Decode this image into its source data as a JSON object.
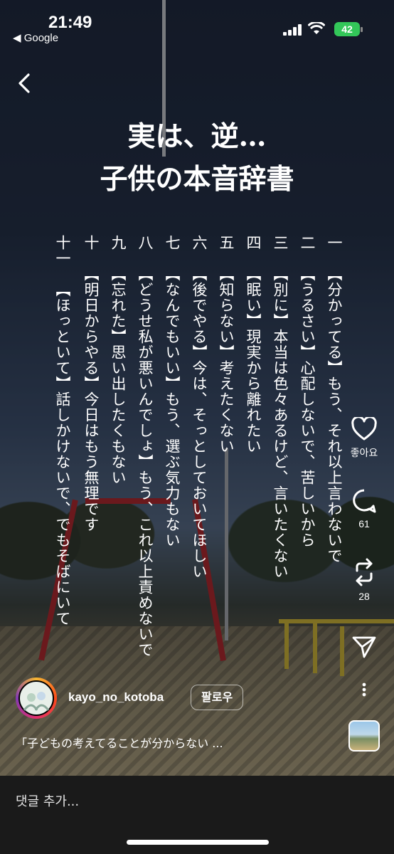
{
  "status_bar": {
    "time": "21:49",
    "back_app": "◀ Google",
    "battery": "42"
  },
  "post": {
    "headline_line1": "実は、逆…",
    "headline_line2": "子供の本音辞書",
    "entries": [
      {
        "num": "一",
        "text": "【分かってる】もう、それ以上言わないで"
      },
      {
        "num": "二",
        "text": "【うるさい】心配しないで、苦しいから"
      },
      {
        "num": "三",
        "text": "【別に】本当は色々あるけど、言いたくない"
      },
      {
        "num": "四",
        "text": "【眠い】現実から離れたい"
      },
      {
        "num": "五",
        "text": "【知らない】考えたくない"
      },
      {
        "num": "六",
        "text": "【後でやる】今は、そっとしておいてほしい"
      },
      {
        "num": "七",
        "text": "【なんでもいい】もう、選ぶ気力もない"
      },
      {
        "num": "八",
        "text": "【どうせ私が悪いんでしょ】もう、これ以上責めないで"
      },
      {
        "num": "九",
        "text": "【忘れた】思い出したくもない"
      },
      {
        "num": "十",
        "text": "【明日からやる】今日はもう無理です"
      },
      {
        "num": "十一",
        "text": "【ほっといて】話しかけないで、でもそばにいて"
      }
    ]
  },
  "actions": {
    "like_label": "좋아요",
    "comment_count": "61",
    "repost_count": "28"
  },
  "account": {
    "username": "kayo_no_kotoba",
    "follow_label": "팔로우",
    "caption": "「子どもの考えてることが分からない ..."
  },
  "comment_bar": {
    "placeholder": "댓글 추가..."
  },
  "colors": {
    "battery_green": "#33c759",
    "comment_bar_bg": "#1a1a1a"
  }
}
